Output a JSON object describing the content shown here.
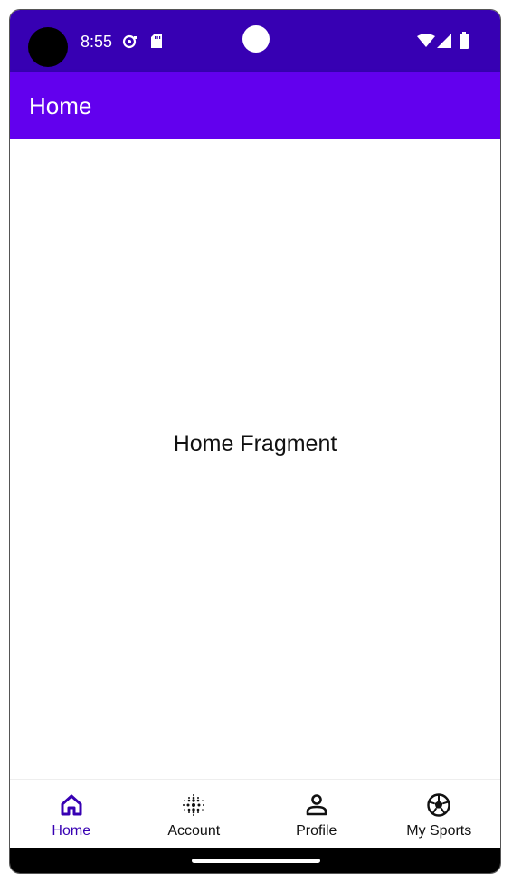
{
  "status_bar": {
    "time": "8:55",
    "icons": [
      "notification-icon",
      "sd-card-icon",
      "wifi-icon",
      "signal-icon",
      "battery-icon"
    ]
  },
  "app_bar": {
    "title": "Home"
  },
  "content": {
    "text": "Home Fragment"
  },
  "bottom_nav": {
    "items": [
      {
        "label": "Home",
        "icon": "home-icon",
        "active": true
      },
      {
        "label": "Account",
        "icon": "dots-grid-icon",
        "active": false
      },
      {
        "label": "Profile",
        "icon": "person-icon",
        "active": false
      },
      {
        "label": "My Sports",
        "icon": "soccer-ball-icon",
        "active": false
      }
    ]
  },
  "colors": {
    "status_bar": "#3700b3",
    "app_bar": "#6200ee",
    "active_nav": "#3700b3"
  }
}
